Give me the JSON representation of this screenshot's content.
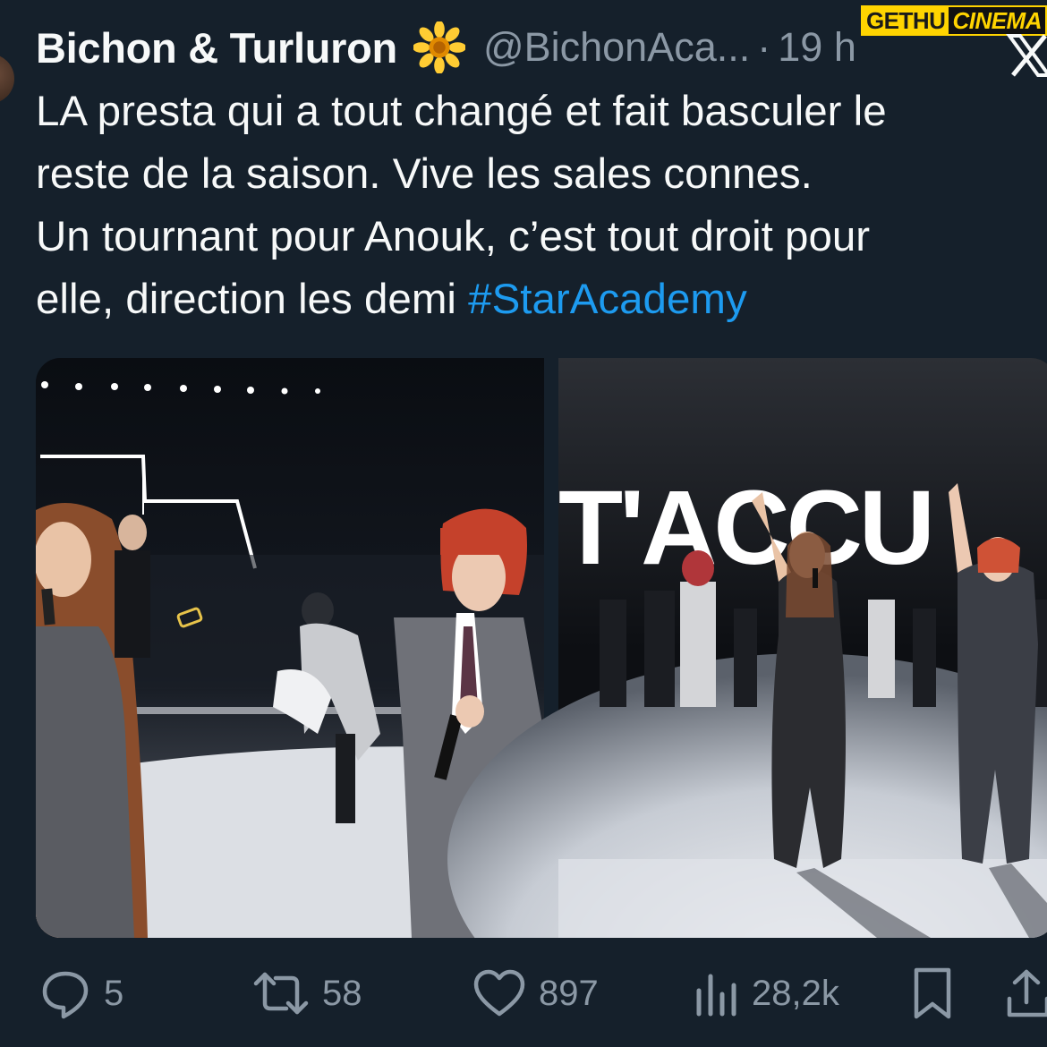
{
  "author": {
    "display_name": "Bichon & Turluron",
    "emoji_icon": "sunflower-emoji",
    "handle": "@BichonAca...",
    "separator": "·",
    "time": "19 h"
  },
  "watermark": {
    "left": "GETHU",
    "right": "CINEMA"
  },
  "tweet": {
    "lines": [
      "LA presta qui a tout changé  et fait basculer le",
      "reste de la saison. Vive les sales connes.",
      "Un tournant pour Anouk, c’est tout droit pour"
    ],
    "last_line_text": "elle, direction les demi ",
    "hashtag": "#StarAcademy"
  },
  "media": {
    "images": [
      {
        "name": "performance-photo-left"
      },
      {
        "name": "performance-photo-right",
        "backdrop_text": "T'ACCU"
      }
    ]
  },
  "actions": {
    "reply": {
      "icon": "reply-icon",
      "count": "5"
    },
    "retweet": {
      "icon": "retweet-icon",
      "count": "58"
    },
    "like": {
      "icon": "heart-icon",
      "count": "897"
    },
    "views": {
      "icon": "views-icon",
      "count": "28,2k"
    },
    "bookmark": {
      "icon": "bookmark-icon"
    },
    "share": {
      "icon": "share-icon"
    }
  },
  "colors": {
    "background": "#15202b",
    "text": "#f7f9f9",
    "secondary": "#8b98a5",
    "link": "#1d9bf0"
  }
}
